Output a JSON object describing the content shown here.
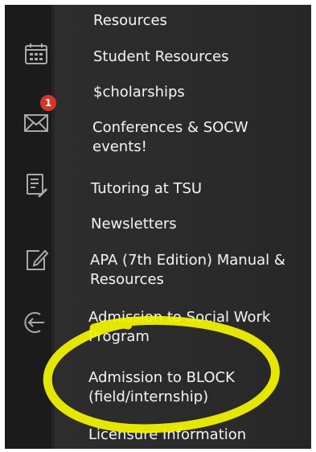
{
  "menu": {
    "partial_top": "Resources",
    "items": [
      {
        "label": "Student Resources"
      },
      {
        "label": "$cholarships"
      },
      {
        "label_lines": [
          "Conferences & SOCW",
          "events!"
        ]
      },
      {
        "label": "Tutoring at TSU"
      },
      {
        "label": "Newsletters"
      },
      {
        "label_lines": [
          "APA (7th Edition) Manual &",
          "Resources"
        ]
      },
      {
        "label_lines": [
          "Admission to Social Work",
          "Program"
        ]
      },
      {
        "label_lines": [
          "Admission to BLOCK",
          "(field/internship)"
        ],
        "highlighted": true
      },
      {
        "label": "Licensure Information"
      }
    ]
  },
  "rail": {
    "notification_count": "1",
    "icons": [
      {
        "name": "calendar-icon"
      },
      {
        "name": "mail-icon"
      },
      {
        "name": "document-icon"
      },
      {
        "name": "edit-icon"
      },
      {
        "name": "sign-out-icon"
      }
    ]
  },
  "colors": {
    "menu_bg": "#2b2b2b",
    "rail_bg": "#1b1b1b",
    "text": "#f1f1f1",
    "badge": "#d7352b",
    "highlighter": "#f6f600"
  }
}
